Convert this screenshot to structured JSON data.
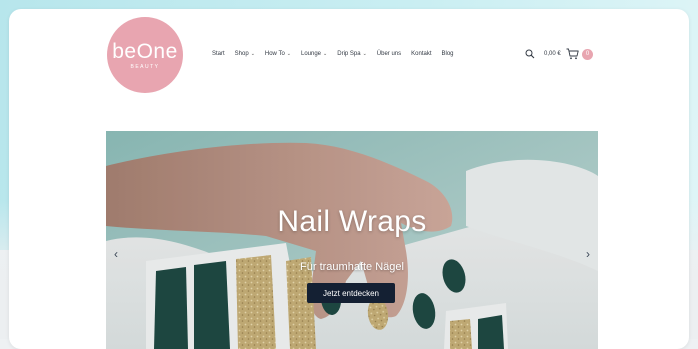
{
  "logo": {
    "main": "beOne",
    "sub": "BEAUTY"
  },
  "nav": {
    "items": [
      {
        "label": "Start",
        "dropdown": false
      },
      {
        "label": "Shop",
        "dropdown": true
      },
      {
        "label": "How To",
        "dropdown": true
      },
      {
        "label": "Lounge",
        "dropdown": true
      },
      {
        "label": "Drip Spa",
        "dropdown": true
      },
      {
        "label": "Über uns",
        "dropdown": false
      },
      {
        "label": "Kontakt",
        "dropdown": false
      },
      {
        "label": "Blog",
        "dropdown": false
      }
    ]
  },
  "cart": {
    "total": "0,00 €",
    "count": "0"
  },
  "hero": {
    "title": "Nail Wraps",
    "subtitle": "Für traumhafte Nägel",
    "button_label": "Jetzt entdecken"
  },
  "slider": {
    "prev": "‹",
    "next": "›"
  },
  "colors": {
    "brand_pink": "#e8a5b0",
    "button_dark": "#142033",
    "nail_green": "#1f4a44",
    "glitter_gold": "#c9b27a"
  }
}
